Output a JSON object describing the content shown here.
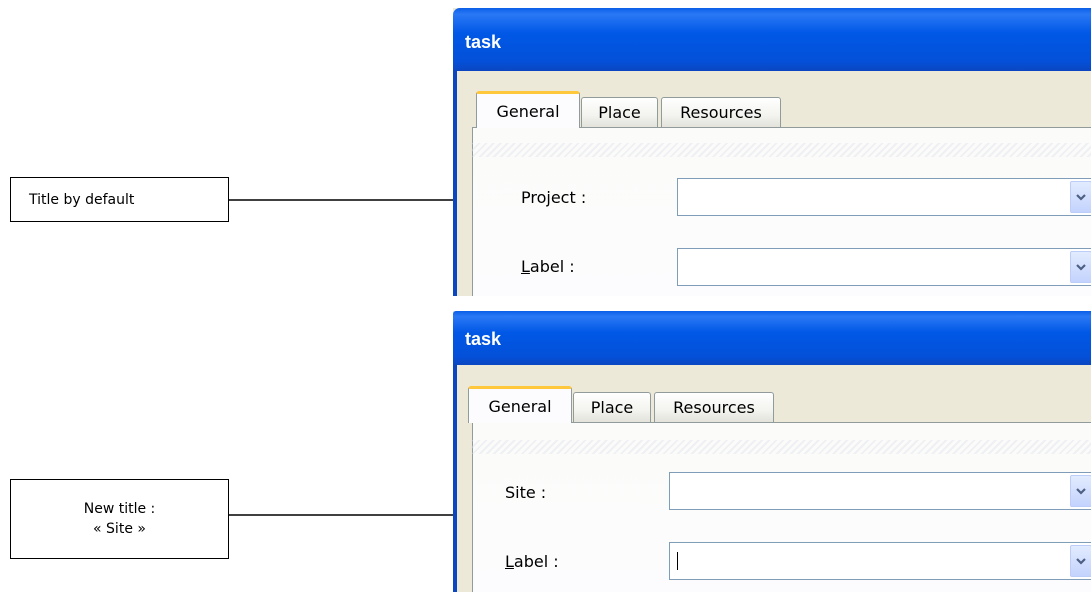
{
  "annotations": [
    {
      "lines": [
        "Title by default"
      ]
    },
    {
      "lines": [
        "New title :",
        "« Site »"
      ]
    }
  ],
  "windows": [
    {
      "title": "task",
      "tabs": [
        "General",
        "Place",
        "Resources"
      ],
      "fields": [
        {
          "label": "Project :",
          "value": ""
        },
        {
          "label_hotkey": "L",
          "label_rest": "abel :",
          "value": ""
        }
      ]
    },
    {
      "title": "task",
      "tabs": [
        "General",
        "Place",
        "Resources"
      ],
      "fields": [
        {
          "label": "Site :",
          "value": ""
        },
        {
          "label_hotkey": "L",
          "label_rest": "abel :",
          "value": ""
        }
      ]
    }
  ],
  "icons": {
    "dropdown": "chevron-down-icon",
    "arrow": "arrow-right-icon"
  },
  "colors": {
    "titlebar": "#0058e6",
    "active_tab_highlight": "#ffc83c",
    "combo_border": "#7f9db9"
  }
}
